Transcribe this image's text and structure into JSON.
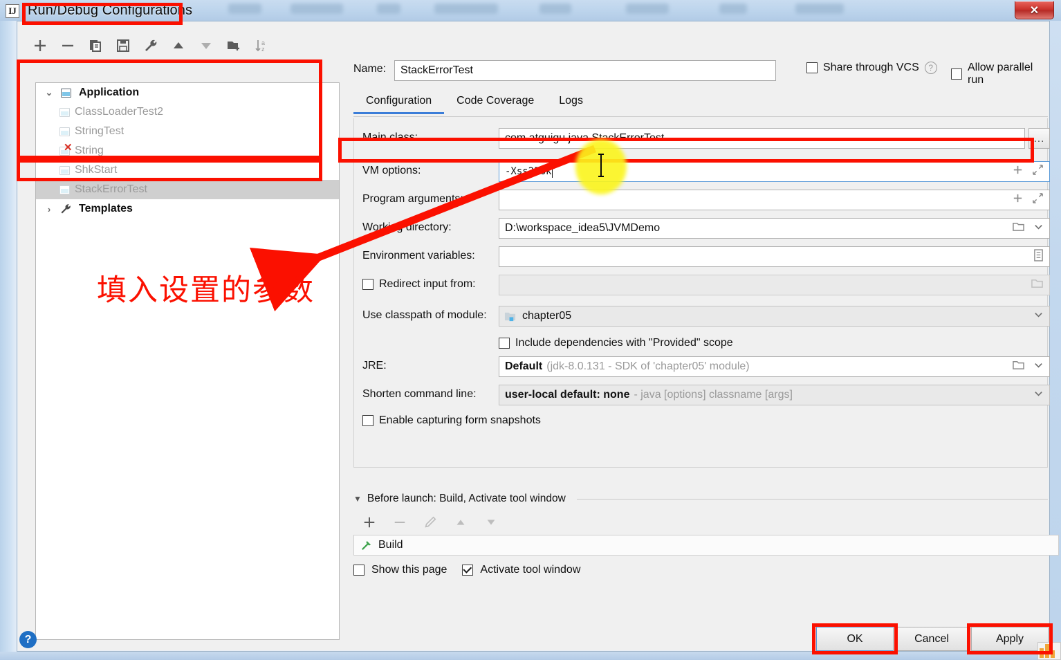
{
  "window": {
    "title": "Run/Debug Configurations",
    "app_icon": "IJ",
    "close_label": "✕"
  },
  "left_toolbar": {
    "icons": [
      "add-icon",
      "remove-icon",
      "copy-icon",
      "save-icon",
      "wrench-icon",
      "move-up-icon",
      "move-down-icon",
      "new-folder-icon",
      "sort-alphabetically-icon"
    ]
  },
  "tree": {
    "group": {
      "label": "Application",
      "twisty": "⌄"
    },
    "children": [
      {
        "label": "ClassLoaderTest2",
        "error": false,
        "selected": false
      },
      {
        "label": "StringTest",
        "error": false,
        "selected": false
      },
      {
        "label": "String",
        "error": true,
        "selected": false
      },
      {
        "label": "ShkStart",
        "error": false,
        "selected": false
      },
      {
        "label": "StackErrorTest",
        "error": false,
        "selected": true
      }
    ],
    "templates": {
      "label": "Templates",
      "twisty": "›"
    }
  },
  "header": {
    "name_label": "Name:",
    "name_value": "StackErrorTest",
    "share_vcs_label": "Share through VCS",
    "share_vcs_checked": false,
    "help_glyph": "?",
    "allow_parallel_label": "Allow parallel run",
    "allow_parallel_checked": false
  },
  "tabs": [
    {
      "label": "Configuration",
      "active": true
    },
    {
      "label": "Code Coverage",
      "active": false
    },
    {
      "label": "Logs",
      "active": false
    }
  ],
  "form": {
    "main_class": {
      "label": "Main class:",
      "value": "com.atguigu.java.StackErrorTest",
      "browse_label": "..."
    },
    "vm_options": {
      "label": "VM options:",
      "value": "-Xss256k",
      "focused": true
    },
    "program_arguments": {
      "label": "Program arguments:",
      "value": ""
    },
    "working_directory": {
      "label": "Working directory:",
      "value": "D:\\workspace_idea5\\JVMDemo"
    },
    "environment_variables": {
      "label": "Environment variables:",
      "value": ""
    },
    "redirect_input": {
      "label": "Redirect input from:",
      "checked": false,
      "value": ""
    },
    "classpath_module": {
      "label": "Use classpath of module:",
      "value": "chapter05"
    },
    "include_provided": {
      "label": "Include dependencies with \"Provided\" scope",
      "checked": false
    },
    "jre": {
      "label": "JRE:",
      "value": "Default",
      "value_hint": "(jdk-8.0.131 - SDK of 'chapter05' module)"
    },
    "shorten_command_line": {
      "label": "Shorten command line:",
      "value": "user-local default: none",
      "value_hint": "- java [options] classname [args]"
    },
    "enable_snapshots": {
      "label": "Enable capturing form snapshots",
      "checked": false
    }
  },
  "before_launch": {
    "header": "Before launch: Build, Activate tool window",
    "twisty": "▼",
    "toolbar_icons": [
      "add-icon",
      "remove-icon",
      "edit-icon",
      "move-up-icon",
      "move-down-icon"
    ],
    "items": [
      {
        "label": "Build",
        "icon": "hammer-icon"
      }
    ],
    "show_this_page": {
      "label": "Show this page",
      "checked": false
    },
    "activate_tool_window": {
      "label": "Activate tool window",
      "checked": true
    }
  },
  "footer": {
    "help_glyph": "?",
    "ok_label": "OK",
    "cancel_label": "Cancel",
    "apply_label": "Apply"
  },
  "annotations": {
    "chinese_note": "填入设置的参数",
    "highlight_color": "#fb1000",
    "cursor_highlight_color": "#fbf51c"
  }
}
